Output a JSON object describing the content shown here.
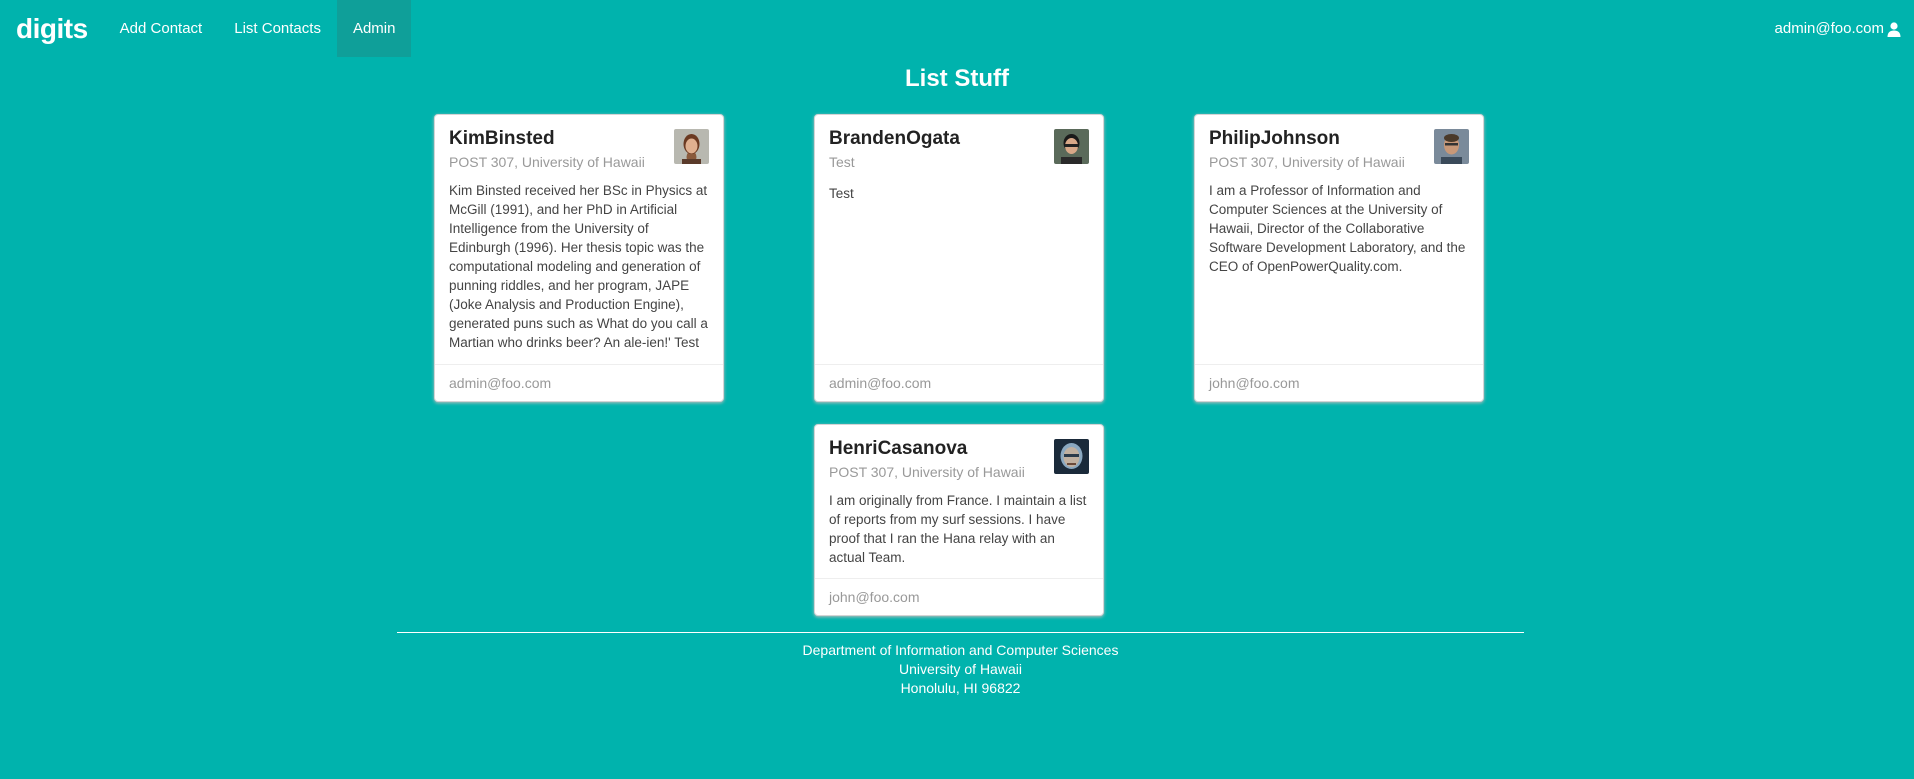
{
  "navbar": {
    "brand": "digits",
    "items": [
      {
        "label": "Add Contact"
      },
      {
        "label": "List Contacts"
      },
      {
        "label": "Admin"
      }
    ],
    "user": "admin@foo.com",
    "user_icon": "user-icon"
  },
  "page": {
    "title": "List Stuff"
  },
  "cards": [
    {
      "name": "KimBinsted",
      "address": "POST 307, University of Hawaii",
      "description": "Kim Binsted received her BSc in Physics at McGill (1991), and her PhD in Artificial Intelligence from the University of Edinburgh (1996). Her thesis topic was the computational modeling and generation of punning riddles, and her program, JAPE (Joke Analysis and Production Engine), generated puns such as What do you call a Martian who drinks beer? An ale-ien!' Test",
      "owner": "admin@foo.com"
    },
    {
      "name": "BrandenOgata",
      "address": "Test",
      "description": "Test",
      "owner": "admin@foo.com"
    },
    {
      "name": "PhilipJohnson",
      "address": "POST 307, University of Hawaii",
      "description": "I am a Professor of Information and Computer Sciences at the University of Hawaii, Director of the Collaborative Software Development Laboratory, and the CEO of OpenPowerQuality.com.",
      "owner": "john@foo.com"
    },
    {
      "name": "HenriCasanova",
      "address": "POST 307, University of Hawaii",
      "description": "I am originally from France. I maintain a list of reports from my surf sessions. I have proof that I ran the Hana relay with an actual Team.",
      "owner": "john@foo.com"
    }
  ],
  "footer": {
    "line1": "Department of Information and Computer Sciences",
    "line2": "University of Hawaii",
    "line3": "Honolulu, HI 96822"
  }
}
